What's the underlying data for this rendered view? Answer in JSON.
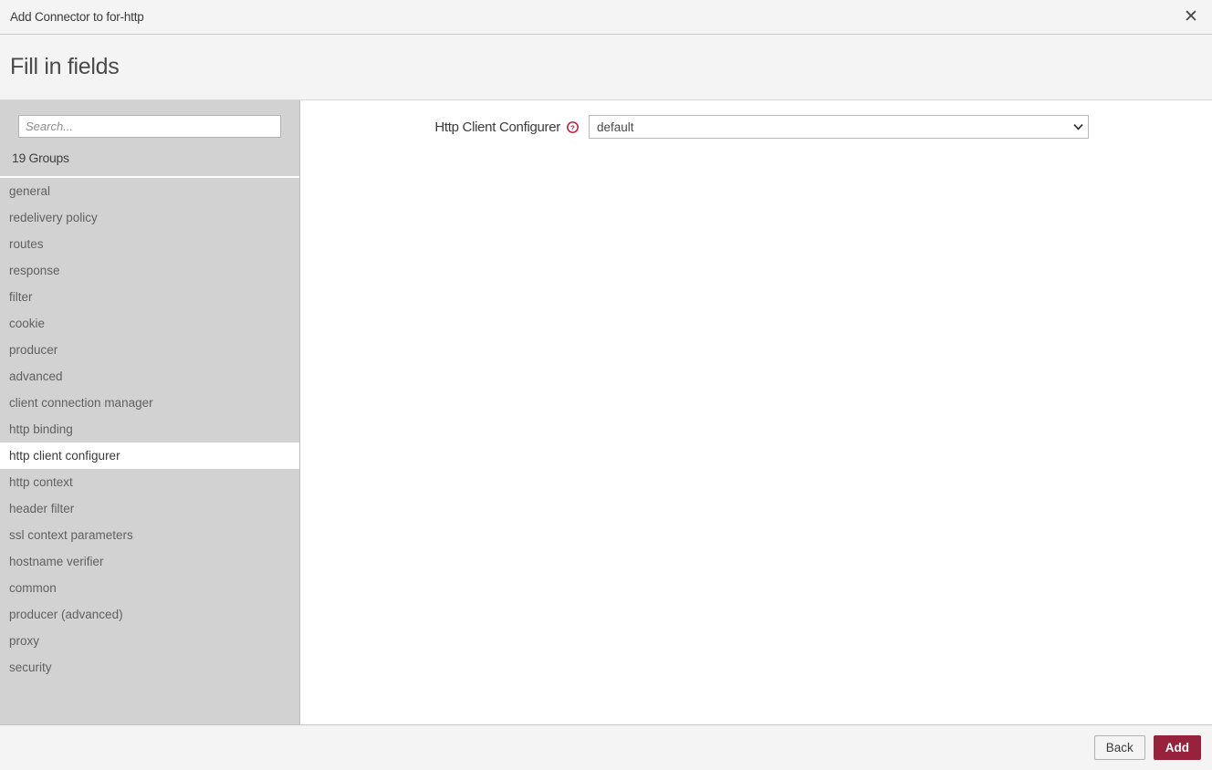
{
  "window": {
    "title": "Add Connector to for-http",
    "close_icon": "close-icon"
  },
  "heading": {
    "text": "Fill in fields"
  },
  "sidebar": {
    "search": {
      "placeholder": "Search...",
      "value": ""
    },
    "groups_count_label": "19 Groups",
    "active_group": "http client configurer",
    "items": [
      {
        "label": "general"
      },
      {
        "label": "redelivery policy"
      },
      {
        "label": "routes"
      },
      {
        "label": "response"
      },
      {
        "label": "filter"
      },
      {
        "label": "cookie"
      },
      {
        "label": "producer"
      },
      {
        "label": "advanced"
      },
      {
        "label": "client connection manager"
      },
      {
        "label": "http binding"
      },
      {
        "label": "http client configurer"
      },
      {
        "label": "http context"
      },
      {
        "label": "header filter"
      },
      {
        "label": "ssl context parameters"
      },
      {
        "label": "hostname verifier"
      },
      {
        "label": "common"
      },
      {
        "label": "producer (advanced)"
      },
      {
        "label": "proxy"
      },
      {
        "label": "security"
      }
    ]
  },
  "form": {
    "fields": [
      {
        "label": "Http Client Configurer",
        "help_icon": "help-circle-icon",
        "control": "select",
        "value": "default",
        "options": [
          "default"
        ]
      }
    ]
  },
  "footer": {
    "back_label": "Back",
    "add_label": "Add"
  },
  "colors": {
    "primary_button": "#96223c",
    "help_icon": "#b5173b",
    "sidebar_bg": "#d2d2d2",
    "chrome_bg": "#f4f4f4"
  }
}
